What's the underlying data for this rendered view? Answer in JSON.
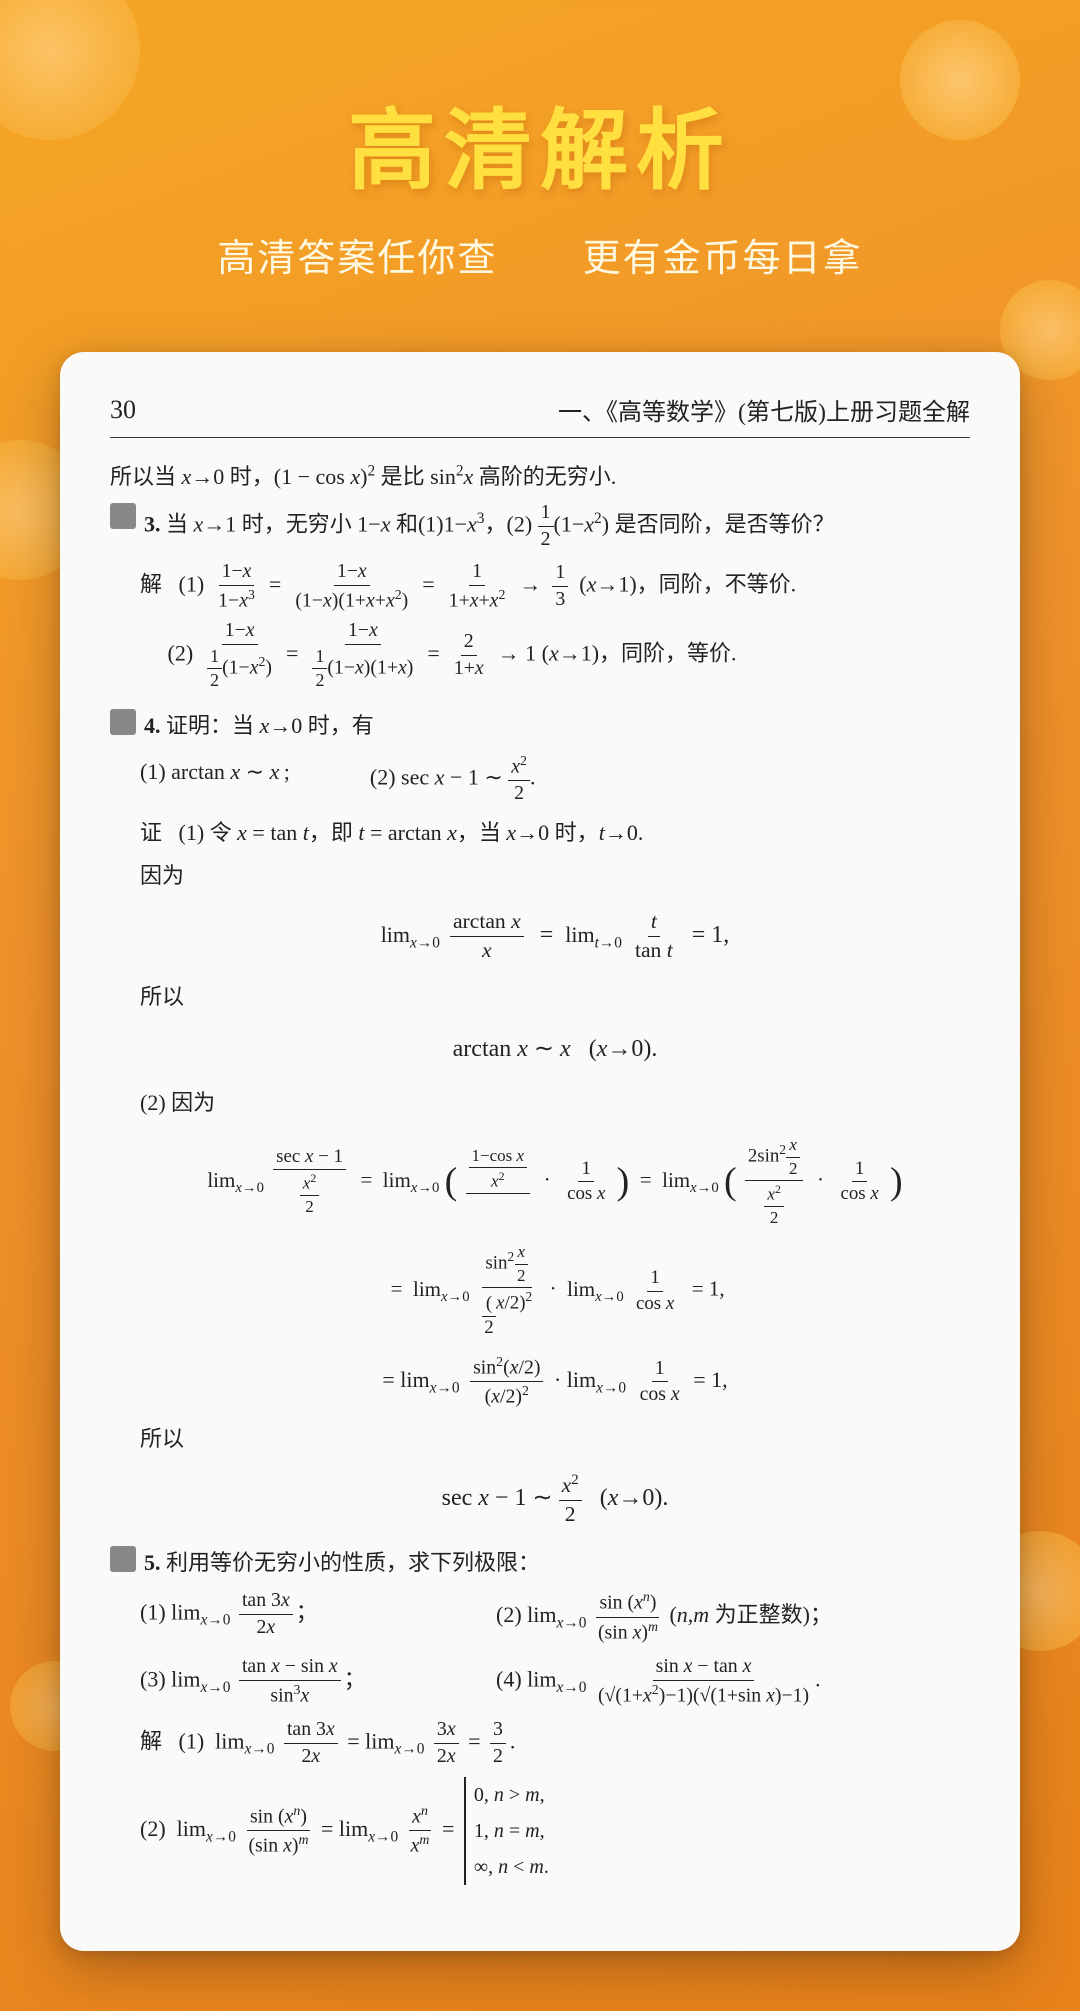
{
  "app": {
    "background_color": "#f5a623"
  },
  "header": {
    "main_title": "高清解析",
    "subtitle_left": "高清答案任你查",
    "subtitle_right": "更有金币每日拿"
  },
  "document": {
    "page_number": "30",
    "book_title": "一、《高等数学》(第七版)上册习题全解",
    "content_lines": [
      "所以当 x→0 时，(1 - cos x)² 是比 sin²x 高阶的无穷小.",
      "3. 当 x→1 时，无穷小 1-x 和(1)1-x³，(2) ½(1-x²) 是否同阶，是否等价？",
      "解  (1) (1-x)/(1-x³) = (1-x)/((1-x)(1+x+x²)) = 1/(1+x+x²) → 1/3 (x→1), 同阶，不等价.",
      "(2) (1-x)/(½(1-x²)) = (1-x)/(½(1-x)(1+x)) = 2/(1+x) → 1 (x→1), 同阶，等价.",
      "4. 证明：当 x→0 时，有",
      "(1) arctan x ~ x;",
      "(2) sec x - 1 ~ x²/2.",
      "证  (1) 令 x = tan t，即 t = arctan x，当 x→0 时，t→0.",
      "因为",
      "lim(x→0) arctan x / x = lim(t→0) t / tan t = 1,",
      "所以",
      "arctan x ~ x  (x→0).",
      "(2) 因为",
      "lim(x→0) (sec x - 1) / (x²/2) = lim(x→0) ((1-cos x)/x²) · (1/cos x) = lim(x→0) (2sin²(x/2)/x²) · (1/cos x)",
      "= lim(x→0) sin²(x/2) / (x/2)² · lim(x→0) 1/cos x = 1,",
      "所以",
      "sec x - 1 ~ x²/2  (x→0).",
      "5. 利用等价无穷小的性质，求下列极限：",
      "(1) lim(x→0) tan 3x / 2x;",
      "(2) lim(x→0) sin(xⁿ) / (sin x)ᵐ (n,m 为正整数);",
      "(3) lim(x→0) (tan x - sin x) / sin³x;",
      "(4) lim(x→0) (sin x - tan x) / ((√(1+x²)-1)(√(1+sin x)-1)).",
      "解  (1) lim(x→0) tan 3x / 2x = lim(x→0) 3x/2x = 3/2.",
      "(2) lim(x→0) sin(xⁿ) / (sin x)ᵐ = lim(x→0) xⁿ/xᵐ = { 0, n>m; 1, n=m; ∞, n<m. }"
    ]
  }
}
